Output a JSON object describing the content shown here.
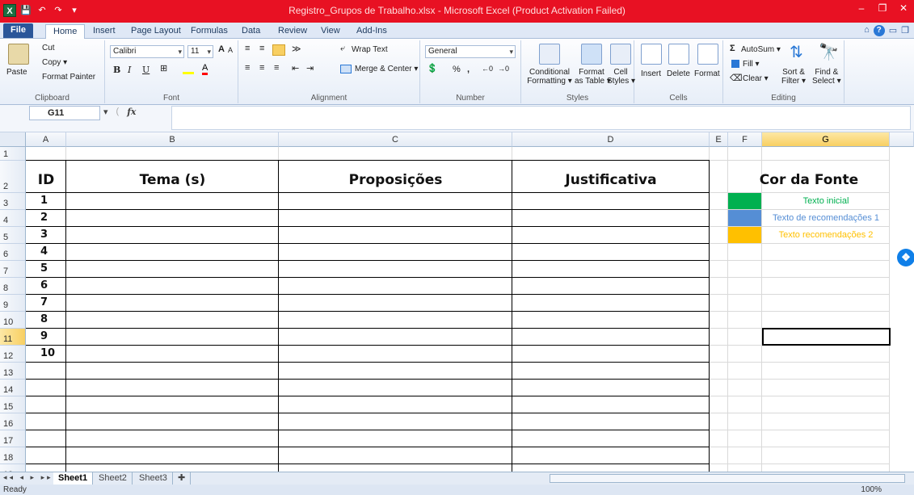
{
  "window": {
    "title": "Registro_Grupos de Trabalho.xlsx - Microsoft Excel (Product Activation Failed)",
    "title_bar_color": "#e81123"
  },
  "ribbon_tabs": [
    "File",
    "Home",
    "Insert",
    "Page Layout",
    "Formulas",
    "Data",
    "Review",
    "View",
    "Add-Ins"
  ],
  "ribbon": {
    "clipboard": {
      "paste": "Paste",
      "cut": "Cut",
      "copy": "Copy ▾",
      "format_painter": "Format Painter",
      "label": "Clipboard"
    },
    "font": {
      "name": "Calibri",
      "size": "11",
      "bold": "B",
      "italic": "I",
      "underline": "U",
      "label": "Font"
    },
    "alignment": {
      "wrap_text": "Wrap Text",
      "merge_center": "Merge & Center ▾",
      "label": "Alignment"
    },
    "number": {
      "format": "General",
      "percent": "%",
      "comma": ",",
      "label": "Number"
    },
    "styles": {
      "conditional_line1": "Conditional",
      "conditional_line2": "Formatting ▾",
      "format_table_line1": "Format",
      "format_table_line2": "as Table ▾",
      "cell_styles_line1": "Cell",
      "cell_styles_line2": "Styles ▾",
      "label": "Styles"
    },
    "cells": {
      "insert": "Insert",
      "delete": "Delete",
      "format": "Format",
      "label": "Cells"
    },
    "editing": {
      "autosum": "AutoSum ▾",
      "fill": "Fill ▾",
      "clear": "Clear ▾",
      "sort_line1": "Sort &",
      "sort_line2": "Filter ▾",
      "find_line1": "Find &",
      "find_line2": "Select ▾",
      "label": "Editing"
    }
  },
  "formula_bar": {
    "name_box": "G11",
    "fx": "fx",
    "content": ""
  },
  "columns": [
    "A",
    "B",
    "C",
    "D",
    "E",
    "F",
    "G"
  ],
  "selected_column": "G",
  "rows": [
    "1",
    "2",
    "3",
    "4",
    "5",
    "6",
    "7",
    "8",
    "9",
    "10",
    "11",
    "12",
    "13",
    "14",
    "15",
    "16",
    "17",
    "18",
    "19"
  ],
  "selected_row": "11",
  "table": {
    "headers": [
      "ID",
      "Tema (s)",
      "Proposições",
      "Justificativa"
    ],
    "ids": [
      "1",
      "2",
      "3",
      "4",
      "5",
      "6",
      "7",
      "8",
      "9",
      "10"
    ]
  },
  "legend": {
    "title": "Cor da Fonte",
    "items": [
      {
        "text": "Texto inicial",
        "color": "#00b050"
      },
      {
        "text": "Texto de recomendações 1",
        "color": "#558ed5"
      },
      {
        "text": "Texto recomendações 2",
        "color": "#ffc000"
      }
    ]
  },
  "sheets": [
    "Sheet1",
    "Sheet2",
    "Sheet3"
  ],
  "active_sheet": "Sheet1",
  "status": {
    "ready": "Ready",
    "zoom": "100%"
  }
}
